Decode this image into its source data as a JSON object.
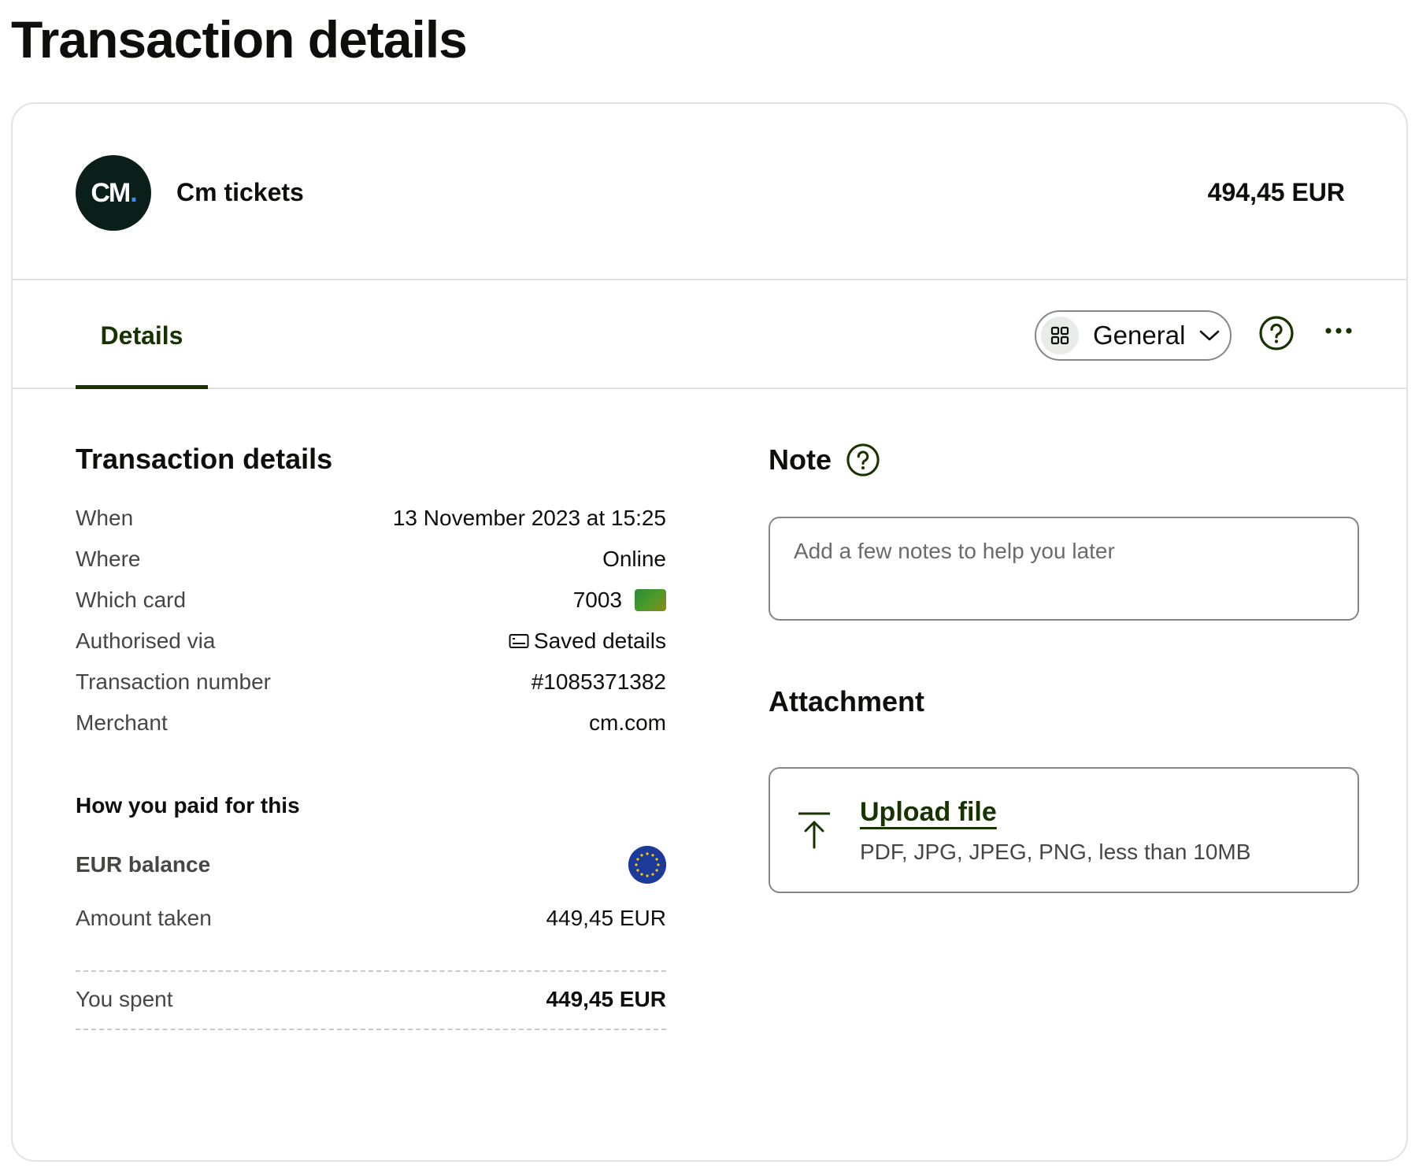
{
  "page": {
    "title": "Transaction details"
  },
  "merchant": {
    "logo_text": "CM",
    "logo_dot": ".",
    "name": "Cm tickets",
    "amount": "494,45 EUR"
  },
  "tabs": [
    {
      "label": "Details",
      "active": true
    }
  ],
  "category": {
    "label": "General",
    "icon": "grid-icon"
  },
  "details": {
    "title": "Transaction details",
    "rows": [
      {
        "label": "When",
        "value": "13 November 2023 at 15:25"
      },
      {
        "label": "Where",
        "value": "Online"
      },
      {
        "label": "Which card",
        "value": "7003"
      },
      {
        "label": "Authorised via",
        "value": "Saved details"
      },
      {
        "label": "Transaction number",
        "value": "#1085371382"
      },
      {
        "label": "Merchant",
        "value": "cm.com"
      }
    ]
  },
  "payment": {
    "title": "How you paid for this",
    "balance_label": "EUR balance",
    "amount_taken_label": "Amount taken",
    "amount_taken_value": "449,45 EUR",
    "spent_label": "You spent",
    "spent_value": "449,45 EUR"
  },
  "note": {
    "title": "Note",
    "placeholder": "Add a few notes to help you later"
  },
  "attachment": {
    "title": "Attachment",
    "upload_label": "Upload file",
    "hint": "PDF, JPG, JPEG, PNG, less than 10MB"
  },
  "colors": {
    "accent": "#163300",
    "border": "#e2e2e2",
    "muted_text": "#454745",
    "eu_blue": "#1c3a99",
    "eu_star": "#ffcc00"
  }
}
